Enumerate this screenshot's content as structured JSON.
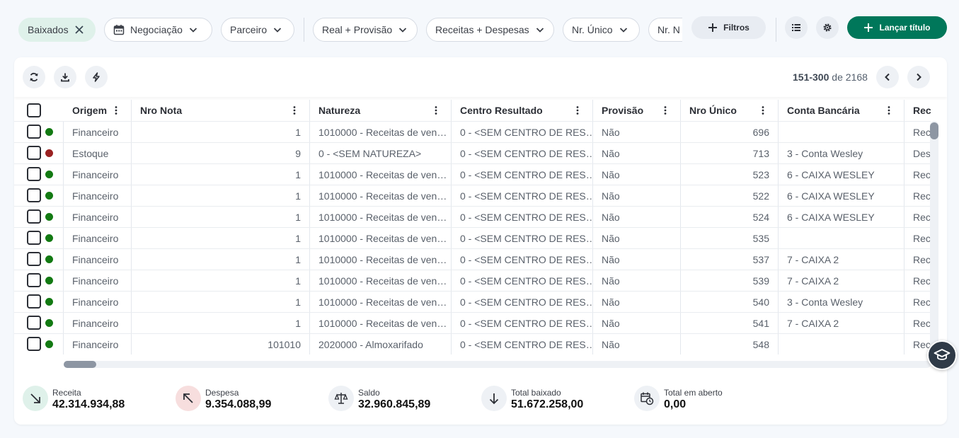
{
  "filters": {
    "active_chip": "Baixados",
    "chips": [
      "Negociação",
      "Parceiro",
      "Real + Provisão",
      "Receitas + Despesas",
      "Nr. Único",
      "Nr. N"
    ],
    "filtros_label": "Filtros",
    "lancar_label": "Lançar título"
  },
  "pager": {
    "range": "151-300",
    "of": "de",
    "total": "2168"
  },
  "columns": [
    "Origem",
    "Nro Nota",
    "Natureza",
    "Centro Resultado",
    "Provisão",
    "Nro Único",
    "Conta Bancária",
    "Recei"
  ],
  "rows": [
    {
      "status": "green",
      "origem": "Financeiro",
      "nota": "1",
      "natureza": "1010000 - Receitas de ven…",
      "centro": "0 - <SEM CENTRO DE RES…",
      "provisao": "Não",
      "unico": "696",
      "conta": "",
      "rec": "Rec"
    },
    {
      "status": "red",
      "origem": "Estoque",
      "nota": "9",
      "natureza": "0 - <SEM NATUREZA>",
      "centro": "0 - <SEM CENTRO DE RES…",
      "provisao": "Não",
      "unico": "713",
      "conta": "3 - Conta Wesley",
      "rec": "Des"
    },
    {
      "status": "green",
      "origem": "Financeiro",
      "nota": "1",
      "natureza": "1010000 - Receitas de ven…",
      "centro": "0 - <SEM CENTRO DE RES…",
      "provisao": "Não",
      "unico": "523",
      "conta": "6 - CAIXA WESLEY",
      "rec": "Rec"
    },
    {
      "status": "green",
      "origem": "Financeiro",
      "nota": "1",
      "natureza": "1010000 - Receitas de ven…",
      "centro": "0 - <SEM CENTRO DE RES…",
      "provisao": "Não",
      "unico": "522",
      "conta": "6 - CAIXA WESLEY",
      "rec": "Rec"
    },
    {
      "status": "green",
      "origem": "Financeiro",
      "nota": "1",
      "natureza": "1010000 - Receitas de ven…",
      "centro": "0 - <SEM CENTRO DE RES…",
      "provisao": "Não",
      "unico": "524",
      "conta": "6 - CAIXA WESLEY",
      "rec": "Rec"
    },
    {
      "status": "green",
      "origem": "Financeiro",
      "nota": "1",
      "natureza": "1010000 - Receitas de ven…",
      "centro": "0 - <SEM CENTRO DE RES…",
      "provisao": "Não",
      "unico": "535",
      "conta": "",
      "rec": "Rec"
    },
    {
      "status": "green",
      "origem": "Financeiro",
      "nota": "1",
      "natureza": "1010000 - Receitas de ven…",
      "centro": "0 - <SEM CENTRO DE RES…",
      "provisao": "Não",
      "unico": "537",
      "conta": "7 - CAIXA 2",
      "rec": "Rec"
    },
    {
      "status": "green",
      "origem": "Financeiro",
      "nota": "1",
      "natureza": "1010000 - Receitas de ven…",
      "centro": "0 - <SEM CENTRO DE RES…",
      "provisao": "Não",
      "unico": "539",
      "conta": "7 - CAIXA 2",
      "rec": "Rec"
    },
    {
      "status": "green",
      "origem": "Financeiro",
      "nota": "1",
      "natureza": "1010000 - Receitas de ven…",
      "centro": "0 - <SEM CENTRO DE RES…",
      "provisao": "Não",
      "unico": "540",
      "conta": "3 - Conta Wesley",
      "rec": "Rec"
    },
    {
      "status": "green",
      "origem": "Financeiro",
      "nota": "1",
      "natureza": "1010000 - Receitas de ven…",
      "centro": "0 - <SEM CENTRO DE RES…",
      "provisao": "Não",
      "unico": "541",
      "conta": "7 - CAIXA 2",
      "rec": "Rec"
    },
    {
      "status": "green",
      "origem": "Financeiro",
      "nota": "101010",
      "natureza": "2020000 - Almoxarifado",
      "centro": "0 - <SEM CENTRO DE RES…",
      "provisao": "Não",
      "unico": "548",
      "conta": "",
      "rec": "Rec"
    }
  ],
  "colors": {
    "green": "#137a13",
    "red": "#9a2222",
    "brand": "#00775a"
  },
  "totals": [
    {
      "label": "Receita",
      "value": "42.314.934,88",
      "icon": "arrow-down-right-icon"
    },
    {
      "label": "Despesa",
      "value": "9.354.088,99",
      "icon": "arrow-up-left-icon"
    },
    {
      "label": "Saldo",
      "value": "32.960.845,89",
      "icon": "scale-icon"
    },
    {
      "label": "Total baixado",
      "value": "51.672.258,00",
      "icon": "arrow-down-icon"
    },
    {
      "label": "Total em aberto",
      "value": "0,00",
      "icon": "calendar-clock-icon"
    }
  ]
}
